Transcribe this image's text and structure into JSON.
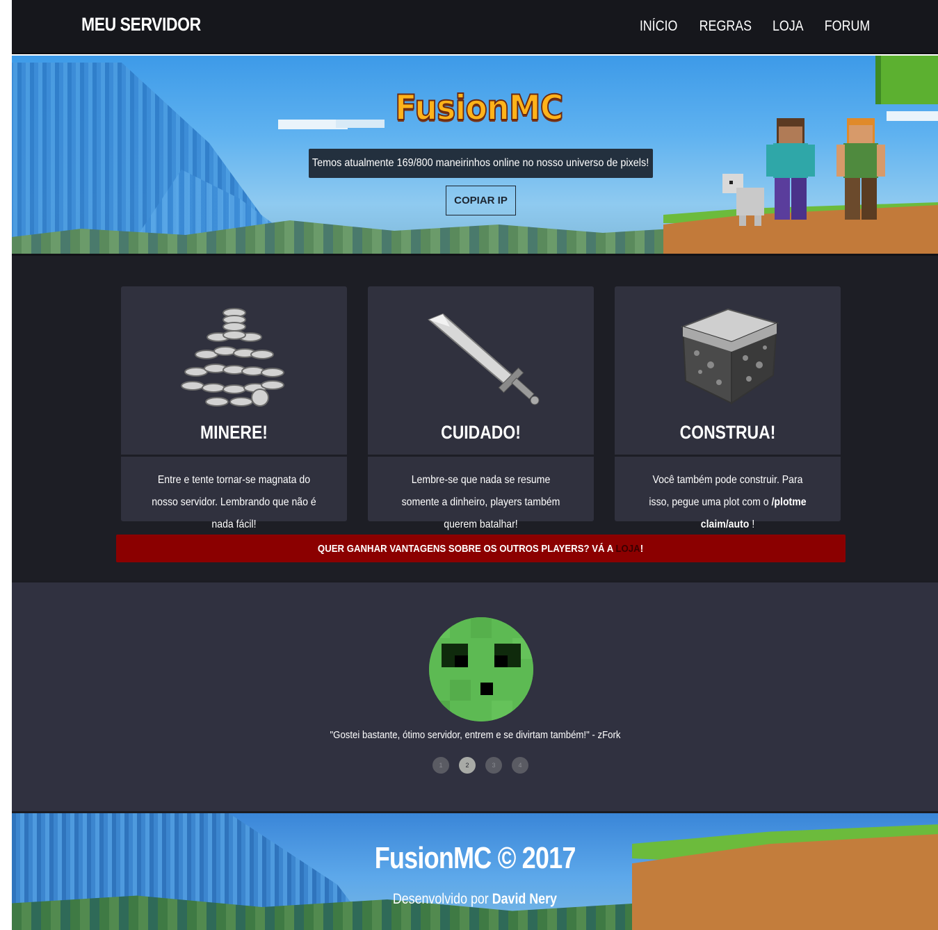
{
  "header": {
    "brand": "MEU SERVIDOR",
    "nav": [
      {
        "label": "INÍCIO"
      },
      {
        "label": "REGRAS"
      },
      {
        "label": "LOJA"
      },
      {
        "label": "FORUM"
      }
    ]
  },
  "hero": {
    "logo_text": "FusionMC",
    "status_text": "Temos atualmente 169/800 maneirinhos online no nosso universo de pixels!",
    "copy_button": "COPIAR IP"
  },
  "features": [
    {
      "icon": "coins-icon",
      "title": "MINERE!",
      "text": "Entre e tente tornar-se magnata do nosso servidor. Lembrando que não é nada fácil!"
    },
    {
      "icon": "sword-icon",
      "title": "CUIDADO!",
      "text": "Lembre-se que nada se resume somente a dinheiro, players também querem batalhar!"
    },
    {
      "icon": "grass-block-icon",
      "title": "CONSTRUA!",
      "text_before": "Você também pode construir. Para isso, pegue uma plot com o ",
      "command": "/plotme claim/auto",
      "text_after": " !"
    }
  ],
  "promo": {
    "text_before": "QUER GANHAR VANTAGENS SOBRE OS OUTROS PLAYERS? VÁ A ",
    "link": "LOJA",
    "text_after": "!"
  },
  "testimonial": {
    "avatar": "slime-icon",
    "quote": "\"Gostei bastante, ótimo servidor, entrem e se divirtam também!\" - zFork",
    "pages": [
      "1",
      "2",
      "3",
      "4"
    ],
    "active_page": "2"
  },
  "footer": {
    "title": "FusionMC © 2017",
    "credit_prefix": "Desenvolvido por ",
    "credit_name": "David Nery"
  },
  "colors": {
    "header_bg": "#16171c",
    "features_bg": "#1d1e25",
    "card_bg": "#30313e",
    "promo_bg": "#8b0000",
    "testimonial_bg": "#303140",
    "logo_orange": "#ffb31a",
    "slime_green": "#5dba53"
  }
}
